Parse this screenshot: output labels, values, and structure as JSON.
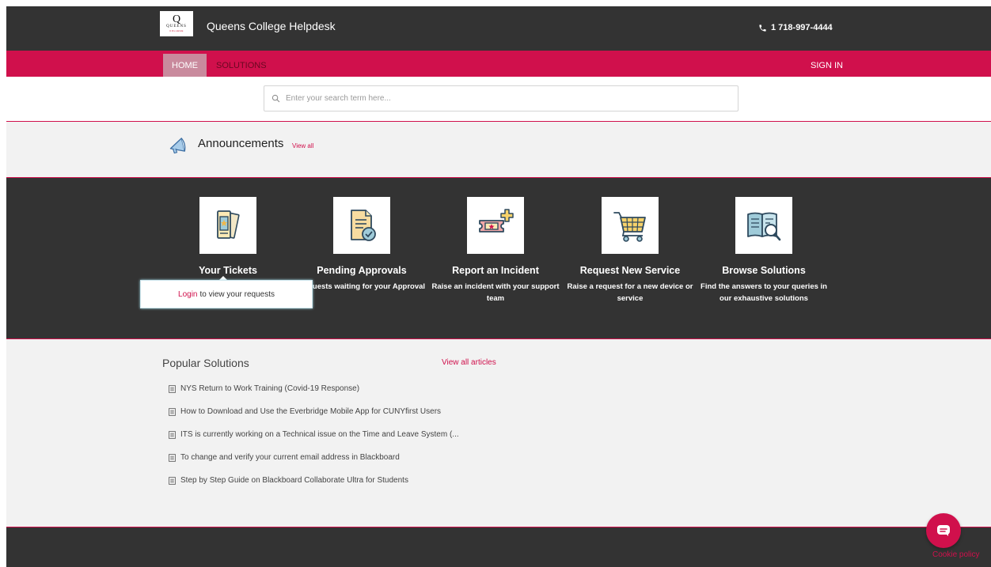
{
  "header": {
    "logo_letter": "Q",
    "logo_name": "QUEENS",
    "logo_sub": "COLLEGE",
    "title": "Queens College Helpdesk",
    "phone": "1 718-997-4444"
  },
  "nav": {
    "home": "HOME",
    "solutions": "SOLUTIONS",
    "signin": "SIGN IN"
  },
  "search": {
    "placeholder": "Enter your search term here..."
  },
  "announcements": {
    "title": "Announcements",
    "view_all": "View all"
  },
  "cards": [
    {
      "title": "Your Tickets",
      "desc": "",
      "icon": "tickets-icon"
    },
    {
      "title": "Pending Approvals",
      "desc": "Requests waiting for your Approval",
      "icon": "approval-document-icon"
    },
    {
      "title": "Report an Incident",
      "desc": "Raise an incident with your support team",
      "icon": "incident-ticket-icon"
    },
    {
      "title": "Request New Service",
      "desc": "Raise a request for a new device or service",
      "icon": "shopping-cart-icon"
    },
    {
      "title": "Browse Solutions",
      "desc": "Find the answers to your queries in our exhaustive solutions",
      "icon": "book-search-icon"
    }
  ],
  "tooltip": {
    "link": "Login",
    "text": "to view your requests"
  },
  "popular": {
    "title": "Popular Solutions",
    "view_all": "View all articles",
    "items": [
      "NYS Return to Work Training (Covid-19 Response)",
      "How to Download and Use the Everbridge Mobile App for CUNYfirst Users",
      "ITS is currently working on a Technical issue on the Time and Leave System (...",
      "To change and verify your current email address in Blackboard",
      "Step by Step Guide on Blackboard Collaborate Ultra for Students"
    ]
  },
  "footer": {
    "cookie": "Cookie policy"
  },
  "colors": {
    "brand": "#d0104c",
    "dark": "#333333",
    "light_bg": "#f2f2f2"
  }
}
